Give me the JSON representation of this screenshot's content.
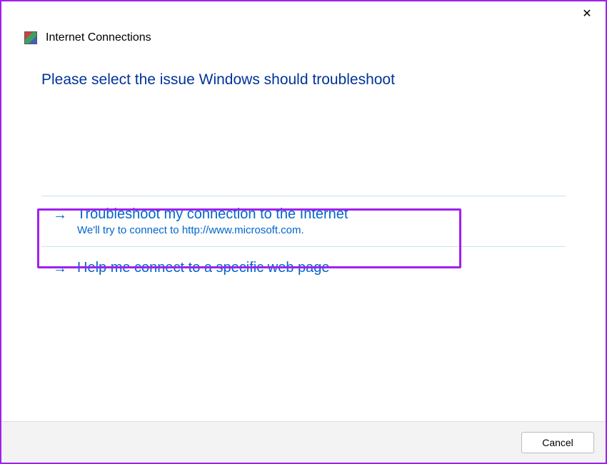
{
  "window": {
    "title": "Internet Connections"
  },
  "main": {
    "instruction": "Please select the issue Windows should troubleshoot",
    "options": [
      {
        "title": "Troubleshoot my connection to the Internet",
        "subtitle": "We'll try to connect to http://www.microsoft.com.",
        "highlighted": true
      },
      {
        "title": "Help me connect to a specific web page",
        "subtitle": "",
        "highlighted": false
      }
    ]
  },
  "footer": {
    "cancel_label": "Cancel"
  },
  "icons": {
    "close": "✕",
    "arrow": "→"
  },
  "colors": {
    "accent_purple": "#a020f0",
    "link_blue": "#0066cc",
    "heading_blue": "#003399"
  }
}
